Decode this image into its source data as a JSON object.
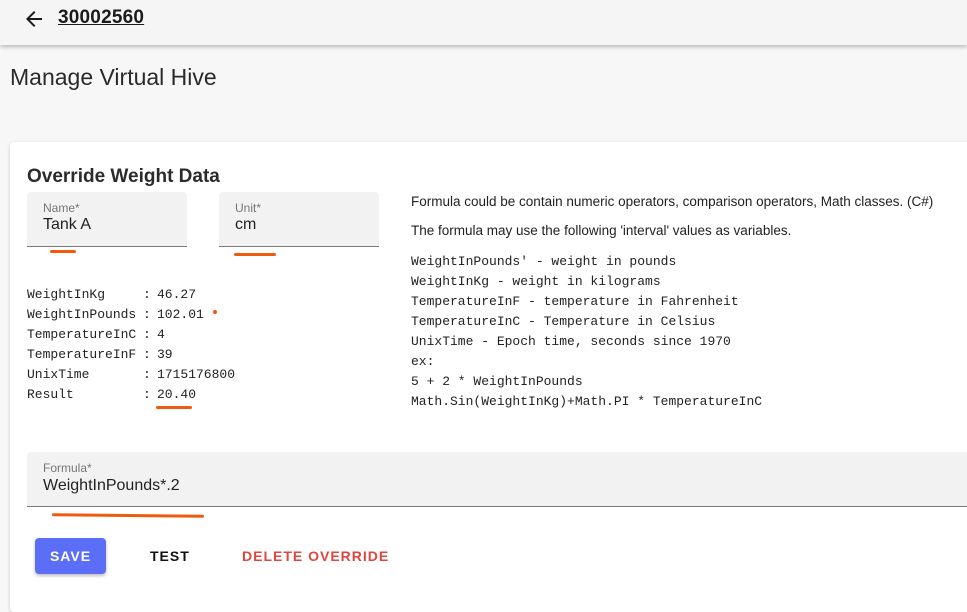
{
  "header": {
    "back_icon": "arrow-left-icon",
    "title": "30002560"
  },
  "page": {
    "title": "Manage Virtual Hive"
  },
  "card": {
    "title": "Override Weight Data",
    "name_field": {
      "label": "Name*",
      "value": "Tank A"
    },
    "unit_field": {
      "label": "Unit*",
      "value": "cm"
    },
    "stats": [
      {
        "key": "WeightInKg",
        "value": "46.27"
      },
      {
        "key": "WeightInPounds",
        "value": "102.01"
      },
      {
        "key": "TemperatureInC",
        "value": "4"
      },
      {
        "key": "TemperatureInF",
        "value": "39"
      },
      {
        "key": "UnixTime",
        "value": "1715176800"
      },
      {
        "key": "Result",
        "value": "20.40"
      }
    ],
    "stat_separator": ":",
    "help": {
      "line1": "Formula could be contain numeric operators, comparison operators, Math classes. (C#)",
      "line2": "The formula may use the following 'interval' values as variables.",
      "code": [
        "WeightInPounds' - weight in pounds",
        "WeightInKg - weight in kilograms",
        "TemperatureInF - temperature in Fahrenheit",
        "TemperatureInC - Temperature in Celsius",
        "UnixTime - Epoch time, seconds since 1970",
        "ex:",
        "5 + 2 * WeightInPounds",
        "Math.Sin(WeightInKg)+Math.PI * TemperatureInC"
      ]
    },
    "formula_field": {
      "label": "Formula*",
      "value": "WeightInPounds*.2"
    },
    "buttons": {
      "save": "SAVE",
      "test": "TEST",
      "delete": "DELETE OVERRIDE"
    }
  },
  "colors": {
    "accent": "#5c6ef8",
    "danger": "#e0463f",
    "annotation": "#f05a0e"
  }
}
